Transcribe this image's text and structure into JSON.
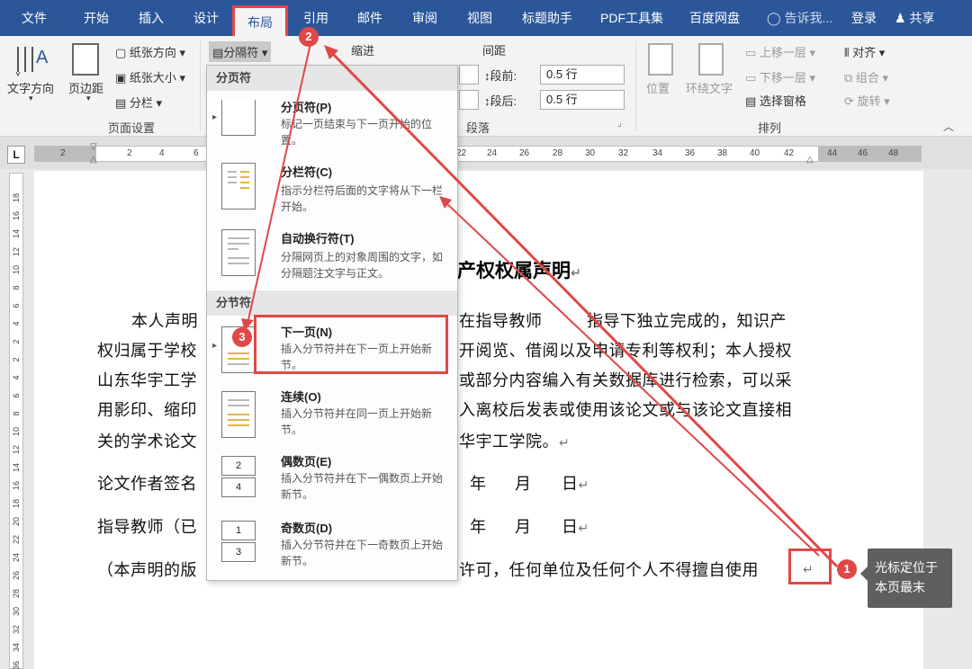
{
  "tabs": [
    "文件",
    "开始",
    "插入",
    "设计",
    "布局",
    "引用",
    "邮件",
    "审阅",
    "视图",
    "标题助手",
    "PDF工具集",
    "百度网盘"
  ],
  "active_tab": "布局",
  "tell_me": "告诉我...",
  "login": "登录",
  "share": "共享",
  "ribbon": {
    "text_direction": "文字方向",
    "margins": "页边距",
    "orientation": "纸张方向",
    "size": "纸张大小",
    "columns": "分栏",
    "breaks": "分隔符",
    "page_setup_group": "页面设置",
    "indent_label": "缩进",
    "spacing_label": "间距",
    "before_label": "段前:",
    "before_value": "0.5 行",
    "after_label": "段后:",
    "after_value": "0.5 行",
    "paragraph_group": "段落",
    "position": "位置",
    "wrap_text": "环绕文字",
    "bring_forward": "上移一层",
    "send_backward": "下移一层",
    "selection_pane": "选择窗格",
    "align": "对齐",
    "group": "组合",
    "rotate": "旋转",
    "arrange_group": "排列"
  },
  "ruler": {
    "corner": "L",
    "ticks": [
      "2",
      "2",
      "4",
      "6",
      "8",
      "22",
      "24",
      "26",
      "28",
      "30",
      "32",
      "34",
      "36",
      "38",
      "40",
      "42",
      "44",
      "46",
      "48"
    ],
    "vticks": [
      "18",
      "16",
      "14",
      "12",
      "10",
      "8",
      "6",
      "4",
      "2",
      "2",
      "4",
      "6",
      "8",
      "10",
      "12",
      "14",
      "16",
      "18",
      "20",
      "22",
      "24",
      "26",
      "28",
      "30",
      "32",
      "34",
      "36"
    ]
  },
  "menu": {
    "section1": "分页符",
    "section2": "分节符",
    "items": [
      {
        "title": "分页符(P)",
        "desc": "标记一页结束与下一页开始的位置。"
      },
      {
        "title": "分栏符(C)",
        "desc": "指示分栏符后面的文字将从下一栏开始。"
      },
      {
        "title": "自动换行符(T)",
        "desc": "分隔网页上的对象周围的文字，如分隔题注文字与正文。"
      },
      {
        "title": "下一页(N)",
        "desc": "插入分节符并在下一页上开始新节。"
      },
      {
        "title": "连续(O)",
        "desc": "插入分节符并在同一页上开始新节。"
      },
      {
        "title": "偶数页(E)",
        "desc": "插入分节符并在下一偶数页上开始新节。"
      },
      {
        "title": "奇数页(D)",
        "desc": "插入分节符并在下一奇数页上开始新节。"
      }
    ],
    "even_icon_nums": [
      "2",
      "4"
    ],
    "odd_icon_nums": [
      "1",
      "3"
    ]
  },
  "document": {
    "title": "产权权属声明",
    "lines": [
      "本人声明",
      "在指导教师",
      "指导下独立完成的，知识产",
      "权归属于学校",
      "开阅览、借阅以及申请专利等权利；本人授权",
      "山东华宇工学",
      "或部分内容编入有关数据库进行检索，可以采",
      "用影印、缩印",
      "入离校后发表或使用该论文或与该论文直接相",
      "关的学术论文",
      "华宇工学院。",
      "论文作者签名",
      "年",
      "月",
      "日",
      "指导教师（已",
      "（本声明的版",
      "许可，任何单位及任何个人不得擅自使用"
    ],
    "return_mark": "↵"
  },
  "badges": [
    "1",
    "2",
    "3"
  ],
  "tooltip": "光标定位于本页最末"
}
